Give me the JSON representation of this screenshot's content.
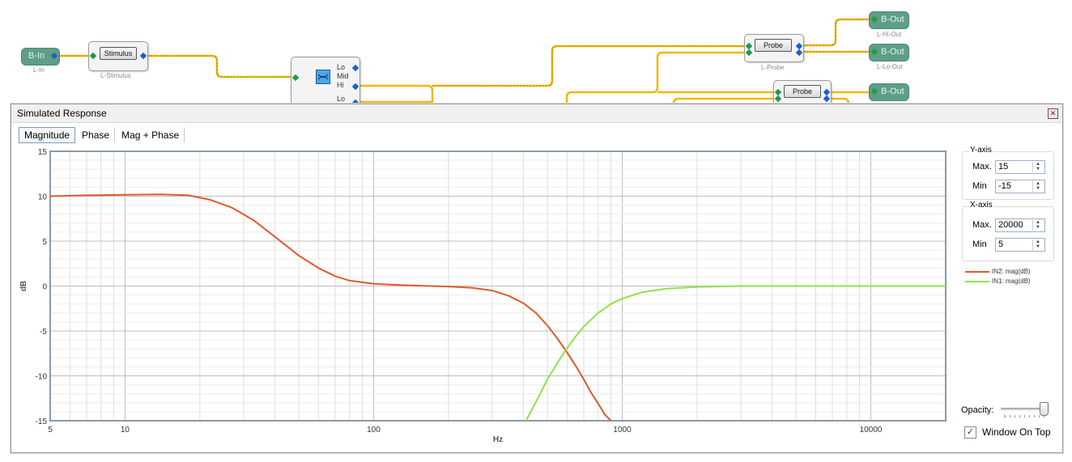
{
  "schematic": {
    "b_in": {
      "label": "B-In",
      "sublabel": "L-In"
    },
    "stimulus": {
      "label": "Stimulus",
      "sublabel": "L-Stimulus"
    },
    "crossover": {
      "ports": [
        "Lo",
        "Mid",
        "Hi",
        "Lo"
      ]
    },
    "probe1": {
      "label": "Probe",
      "sublabel": "L-Probe"
    },
    "probe2": {
      "label": "Probe"
    },
    "out_hi": {
      "label": "B-Out",
      "sublabel": "L-Hi-Out"
    },
    "out_lo": {
      "label": "B-Out",
      "sublabel": "L-Lo-Out"
    },
    "out_3": {
      "label": "B-Out"
    }
  },
  "window": {
    "title": "Simulated Response",
    "close_glyph": "✕",
    "tabs": [
      "Magnitude",
      "Phase",
      "Mag + Phase"
    ],
    "active_tab": "Magnitude"
  },
  "panel": {
    "y_axis": {
      "title": "Y-axis",
      "max_label": "Max.",
      "max_value": "15",
      "min_label": "Min",
      "min_value": "-15"
    },
    "x_axis": {
      "title": "X-axis",
      "max_label": "Max.",
      "max_value": "20000",
      "min_label": "Min",
      "min_value": "5"
    },
    "opacity_label": "Opacity:",
    "opacity_level": 1.0,
    "window_on_top_label": "Window On Top",
    "window_on_top_checked": true
  },
  "colors": {
    "wire": "#f2b705",
    "series_in2": "#e05a2b",
    "series_in1": "#8fe34a",
    "plot_border": "#8a9aa8"
  },
  "chart_data": {
    "type": "line",
    "xscale": "log",
    "xlim": [
      5,
      20000
    ],
    "ylim": [
      -15,
      15
    ],
    "xlabel": "Hz",
    "ylabel": "dB",
    "grid": true,
    "legend_position": "right",
    "xticks": [
      5,
      10,
      100,
      1000,
      10000
    ],
    "yticks": [
      15,
      10,
      5,
      0,
      -5,
      -10,
      -15
    ],
    "series": [
      {
        "name": "IN2: mag(dB)",
        "x": [
          5,
          7,
          10,
          14,
          18,
          22,
          27,
          33,
          40,
          50,
          60,
          70,
          80,
          100,
          130,
          170,
          200,
          250,
          300,
          350,
          400,
          450,
          500,
          550,
          600,
          650,
          700,
          750,
          800,
          850,
          900
        ],
        "y": [
          10.0,
          10.1,
          10.15,
          10.2,
          10.1,
          9.6,
          8.7,
          7.3,
          5.5,
          3.4,
          2.0,
          1.1,
          0.6,
          0.25,
          0.1,
          0.0,
          -0.05,
          -0.2,
          -0.5,
          -1.1,
          -1.9,
          -3.0,
          -4.4,
          -5.9,
          -7.4,
          -8.9,
          -10.4,
          -11.9,
          -13.1,
          -14.3,
          -15.0
        ]
      },
      {
        "name": "IN1: mag(dB)",
        "x": [
          410,
          450,
          500,
          550,
          600,
          650,
          700,
          800,
          900,
          1000,
          1200,
          1500,
          2000,
          3000,
          5000,
          10000,
          20000
        ],
        "y": [
          -15.0,
          -12.9,
          -10.4,
          -8.5,
          -6.9,
          -5.6,
          -4.5,
          -3.0,
          -2.0,
          -1.4,
          -0.7,
          -0.3,
          -0.1,
          0.0,
          0.0,
          0.0,
          0.0
        ]
      }
    ]
  }
}
